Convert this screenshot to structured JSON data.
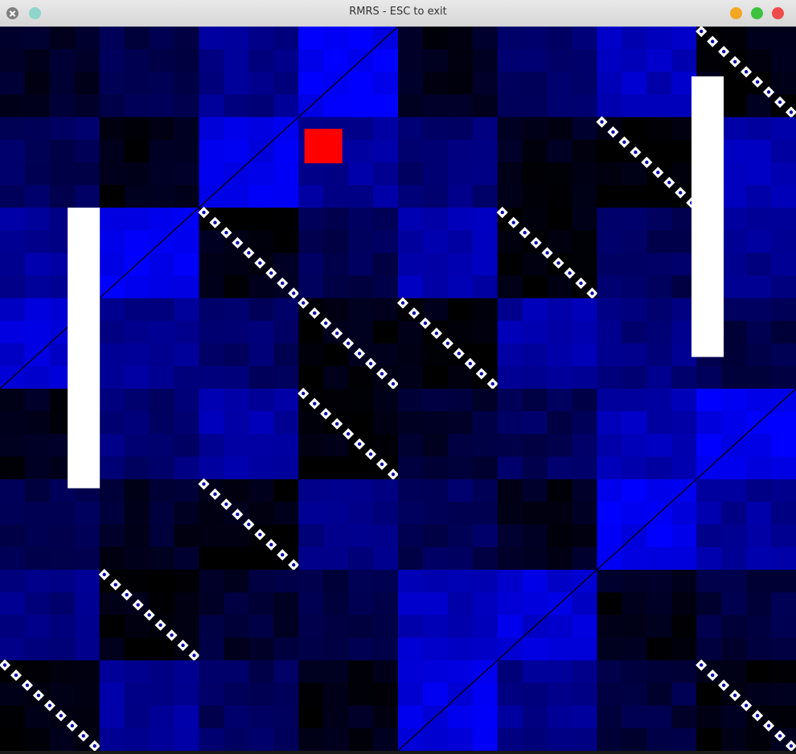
{
  "window": {
    "title": "RMRS - ESC to exit"
  },
  "game": {
    "grid": {
      "columns": 8,
      "rows": 8,
      "sub_cells": 4
    },
    "colors": {
      "background_dark": "#000000",
      "field_blue": "#0000ff",
      "paddle": "#ffffff",
      "ball": "#ff0000",
      "diagonal_marker": "#ffffff"
    },
    "tile_brightness": [
      [
        0.15,
        0.3,
        0.55,
        0.95,
        0.12,
        0.4,
        0.75,
        0.05
      ],
      [
        0.35,
        0.08,
        0.9,
        0.6,
        0.45,
        0.1,
        0.02,
        0.7
      ],
      [
        0.6,
        0.95,
        0.05,
        0.3,
        0.7,
        0.01,
        0.35,
        0.55
      ],
      [
        0.85,
        0.55,
        0.4,
        0.04,
        0.02,
        0.65,
        0.5,
        0.3
      ],
      [
        0.1,
        0.45,
        0.65,
        0.02,
        0.2,
        0.35,
        0.7,
        0.95
      ],
      [
        0.3,
        0.15,
        0.03,
        0.55,
        0.35,
        0.12,
        0.95,
        0.6
      ],
      [
        0.5,
        0.03,
        0.2,
        0.3,
        0.75,
        0.85,
        0.1,
        0.25
      ],
      [
        0.03,
        0.6,
        0.35,
        0.08,
        0.9,
        0.55,
        0.25,
        0.05
      ]
    ],
    "paddles": [
      {
        "name": "left",
        "column": 0.68,
        "top_row": 2.0,
        "rows_tall": 3.1
      },
      {
        "name": "right",
        "column": 6.95,
        "top_row": 0.55,
        "rows_tall": 3.1
      }
    ],
    "ball": {
      "column": 3.06,
      "row": 1.13,
      "size": 0.38
    }
  }
}
